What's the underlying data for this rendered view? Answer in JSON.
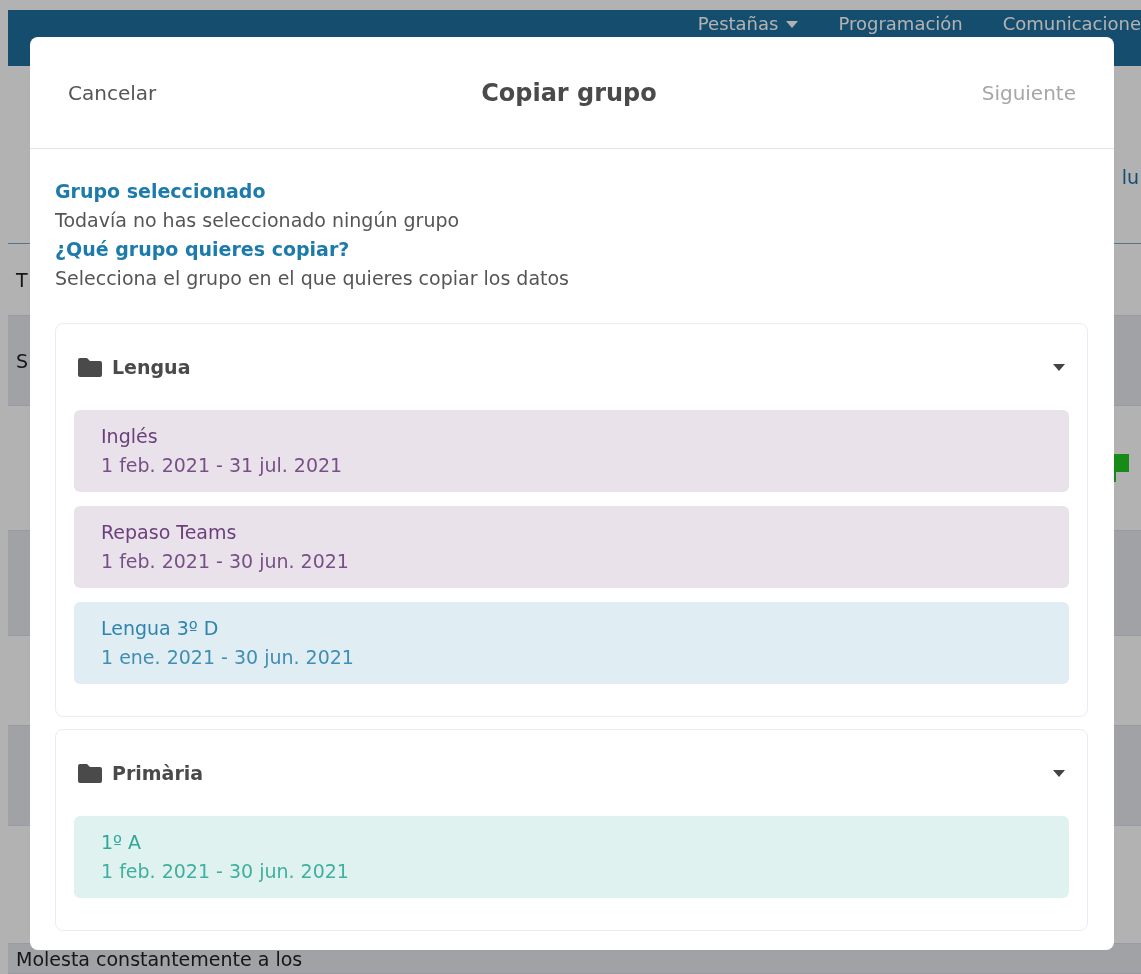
{
  "background": {
    "nav_tabs": [
      {
        "label": "Pestañas",
        "dropdown": true
      },
      {
        "label": "Programación",
        "dropdown": false
      },
      {
        "label": "Comunicacione",
        "dropdown": false
      }
    ],
    "column_header": "lu",
    "rows": [
      {
        "text": "T",
        "flagged": false
      },
      {
        "text": "S",
        "flagged": false
      },
      {
        "flagged": true
      },
      {
        "flagged": false
      },
      {
        "flagged": false
      },
      {
        "flagged": false
      },
      {
        "flagged": false
      },
      {
        "text": "Molesta constantemente a los",
        "flagged": false
      }
    ]
  },
  "dialog": {
    "cancel": "Cancelar",
    "title": "Copiar grupo",
    "next": "Siguiente",
    "next_disabled": true,
    "selected_heading": "Grupo seleccionado",
    "selected_text": "Todavía no has seleccionado ningún grupo",
    "question": "¿Qué grupo quieres copiar?",
    "hint": "Selecciona el grupo en el que quieres copiar los datos",
    "folders": [
      {
        "name": "Lengua",
        "expanded": true,
        "groups": [
          {
            "name": "Inglés",
            "dates": "1 feb. 2021 - 31 jul. 2021",
            "color": "#6b3f7a"
          },
          {
            "name": "Repaso Teams",
            "dates": "1 feb. 2021 - 30 jun. 2021",
            "color": "#6b3f7a"
          },
          {
            "name": "Lengua 3º D",
            "dates": "1 ene. 2021 - 30 jun. 2021",
            "color": "#2f84ad"
          }
        ]
      },
      {
        "name": "Primària",
        "expanded": true,
        "groups": [
          {
            "name": "1º A",
            "dates": "1 feb. 2021 - 30 jun. 2021",
            "color": "#2ea898"
          }
        ]
      }
    ]
  }
}
